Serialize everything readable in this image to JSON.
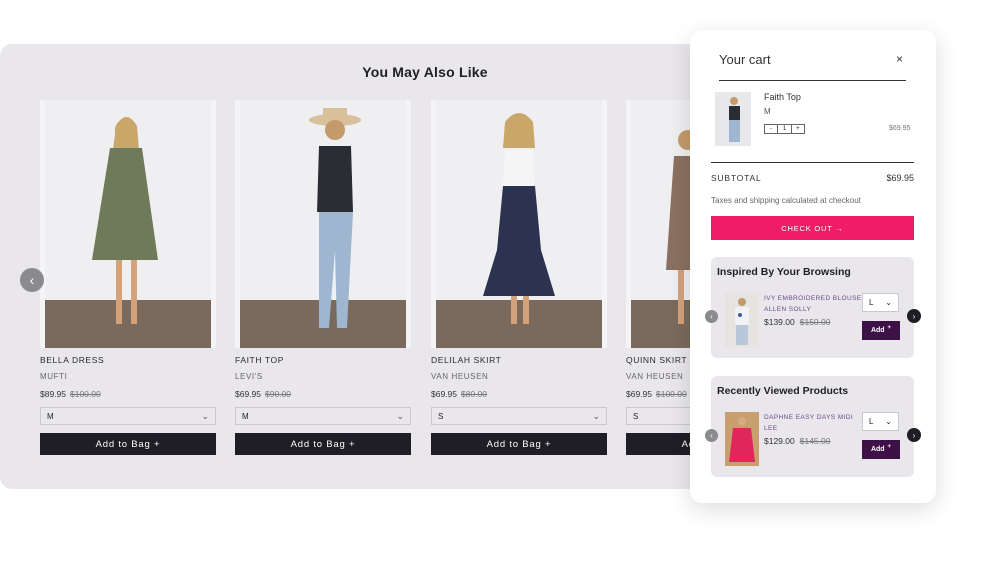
{
  "carousel": {
    "title": "You May Also Like",
    "prev_icon": "‹",
    "products": [
      {
        "name": "BELLA DRESS",
        "brand": "MUFTI",
        "price": "$89.95",
        "old_price": "$100.00",
        "size": "M",
        "cta": "Add to Bag +",
        "color": "#6f7a5b"
      },
      {
        "name": "FAITH TOP",
        "brand": "LEVI'S",
        "price": "$69.95",
        "old_price": "$90.00",
        "size": "M",
        "cta": "Add to Bag +",
        "color": "#2a2d33"
      },
      {
        "name": "DELILAH SKIRT",
        "brand": "VAN HEUSEN",
        "price": "$69.95",
        "old_price": "$80.00",
        "size": "S",
        "cta": "Add to Bag +",
        "color": "#2c3350"
      },
      {
        "name": "QUINN SKIRT",
        "brand": "VAN HEUSEN",
        "price": "$69.95",
        "old_price": "$100.00",
        "size": "S",
        "cta": "Add to Bag +",
        "color": "#8a7060"
      }
    ]
  },
  "cart": {
    "title": "Your cart",
    "close_icon": "×",
    "item": {
      "name": "Faith Top",
      "size": "M",
      "qty_minus": "-",
      "qty": "1",
      "qty_plus": "+",
      "price": "$69.95"
    },
    "subtotal_label": "SUBTOTAL",
    "subtotal_value": "$69.95",
    "tax_note": "Taxes and shipping calculated at checkout",
    "checkout_label": "CHECK OUT →",
    "inspired": {
      "title": "Inspired By Your Browsing",
      "name": "IVY EMBROIDERED BLOUSE ALLEN SOLLY",
      "price": "$139.00",
      "old_price": "$150.00",
      "size": "L",
      "add_label": "Add",
      "add_plus": "+",
      "prev_icon": "‹",
      "next_icon": "›"
    },
    "recent": {
      "title": "Recently Viewed Products",
      "name": "DAPHNE EASY DAYS MIDI LEE",
      "price": "$129.00",
      "old_price": "$145.00",
      "size": "L",
      "add_label": "Add",
      "add_plus": "+",
      "prev_icon": "‹",
      "next_icon": "›"
    }
  },
  "colors": {
    "checkout": "#ee1d66",
    "add_button": "#3d1048",
    "dark": "#1e1e24"
  }
}
